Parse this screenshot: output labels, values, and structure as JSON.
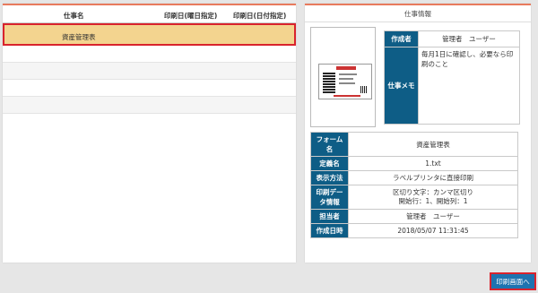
{
  "jobs": {
    "headers": {
      "name": "仕事名",
      "weekday_print": "印刷日(曜日指定)",
      "date_print": "印刷日(日付指定)"
    },
    "rows": [
      {
        "name": "資産管理表",
        "selected": true
      },
      {
        "name": ""
      },
      {
        "name": ""
      },
      {
        "name": ""
      },
      {
        "name": ""
      }
    ]
  },
  "job_info": {
    "title": "仕事情報",
    "creator_label": "作成者",
    "creator_value": "管理者　ユーザー",
    "memo_label": "仕事メモ",
    "memo_value": "毎月1日に確認し、必要なら印刷のこと",
    "details": [
      {
        "label": "フォーム名",
        "value": "資産管理表"
      },
      {
        "label": "定義名",
        "value": "1.txt"
      },
      {
        "label": "表示方法",
        "value": "ラベルプリンタに直接印刷"
      },
      {
        "label": "印刷データ情報",
        "value": "区切り文字：カンマ区切り\n開始行：1、開始列：1"
      },
      {
        "label": "担当者",
        "value": "管理者　ユーザー"
      },
      {
        "label": "作成日時",
        "value": "2018/05/07 11:31:45"
      }
    ]
  },
  "print_button_label": "印刷画面へ",
  "colors": {
    "accent": "#0e5d86",
    "selected_row": "#f3d48f",
    "highlight_border": "#d9232d",
    "button": "#1e73b0"
  }
}
